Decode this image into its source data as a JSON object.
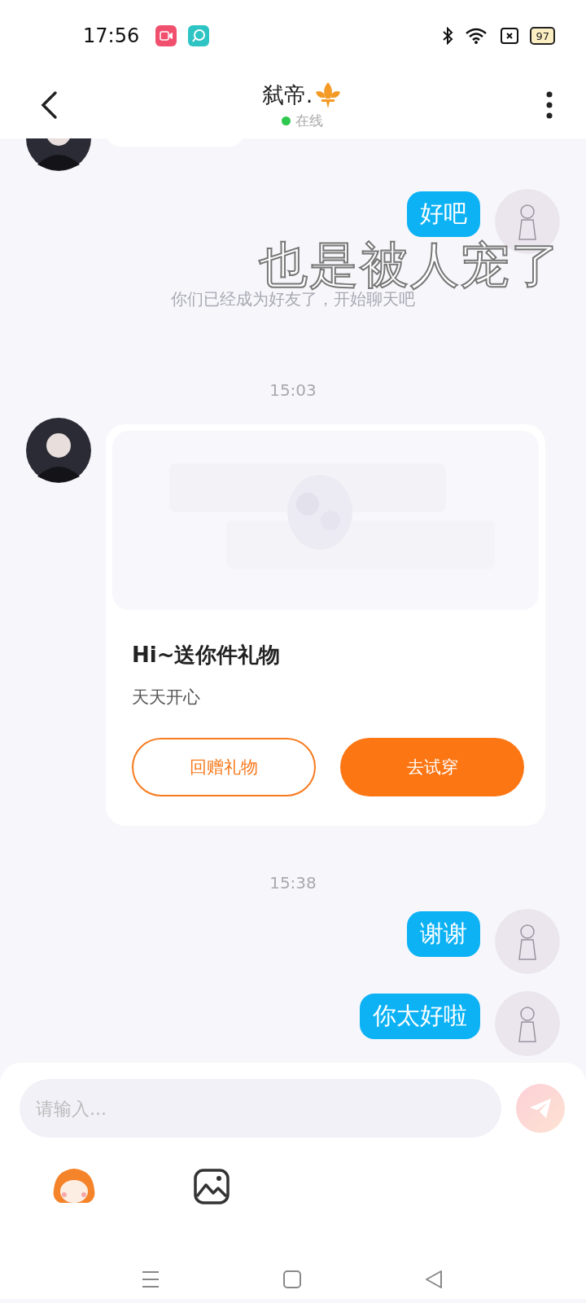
{
  "status_bar": {
    "time": "17:56",
    "battery": "97"
  },
  "header": {
    "title": "弑帝.",
    "online": true,
    "status": "在线"
  },
  "messages": [
    {
      "kind": "partial",
      "outgoing": false
    },
    {
      "kind": "text",
      "outgoing": true,
      "text": "好吧"
    },
    {
      "kind": "system",
      "text": "你们已经成为好友了，开始聊天吧"
    },
    {
      "kind": "time",
      "text": "15:03"
    },
    {
      "kind": "gift",
      "outgoing": false,
      "title": "Hi~送你件礼物",
      "subtitle": "天天开心",
      "buttons": [
        {
          "label": "回赠礼物",
          "kind": "outline"
        },
        {
          "label": "去试穿",
          "kind": "filled"
        }
      ]
    },
    {
      "kind": "time",
      "text": "15:38"
    },
    {
      "kind": "text",
      "outgoing": true,
      "text": "谢谢"
    },
    {
      "kind": "text",
      "outgoing": true,
      "text": "你太好啦"
    }
  ],
  "caption": "也是被人宠了",
  "composer": {
    "placeholder": "请输入..."
  }
}
